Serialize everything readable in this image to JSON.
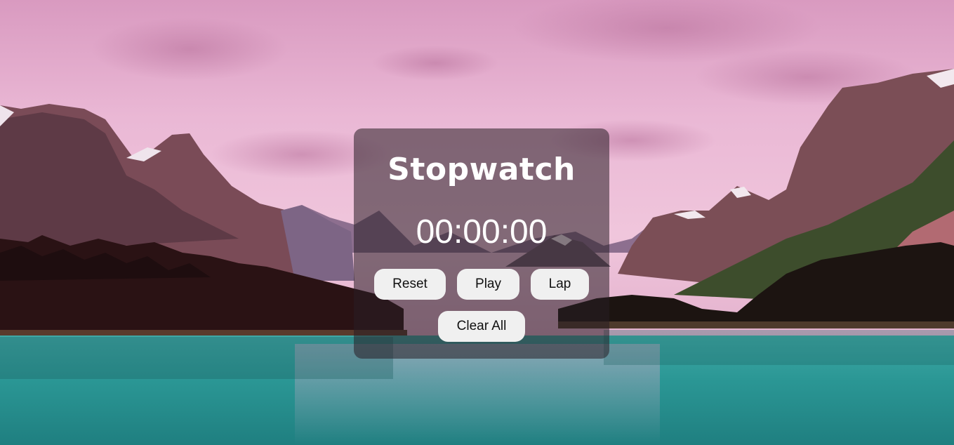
{
  "stopwatch": {
    "title": "Stopwatch",
    "time": "00:00:00",
    "buttons": {
      "reset": "Reset",
      "play": "Play",
      "lap": "Lap",
      "clear_all": "Clear All"
    }
  },
  "theme": {
    "card_bg": "#281e24",
    "button_bg": "#f0f0f0",
    "button_text": "#111111",
    "title_text": "#ffffff",
    "sky": "#e7b2cf",
    "lake": "#2a9a98"
  },
  "background": {
    "scene": "pink-sky-mountain-lake"
  }
}
